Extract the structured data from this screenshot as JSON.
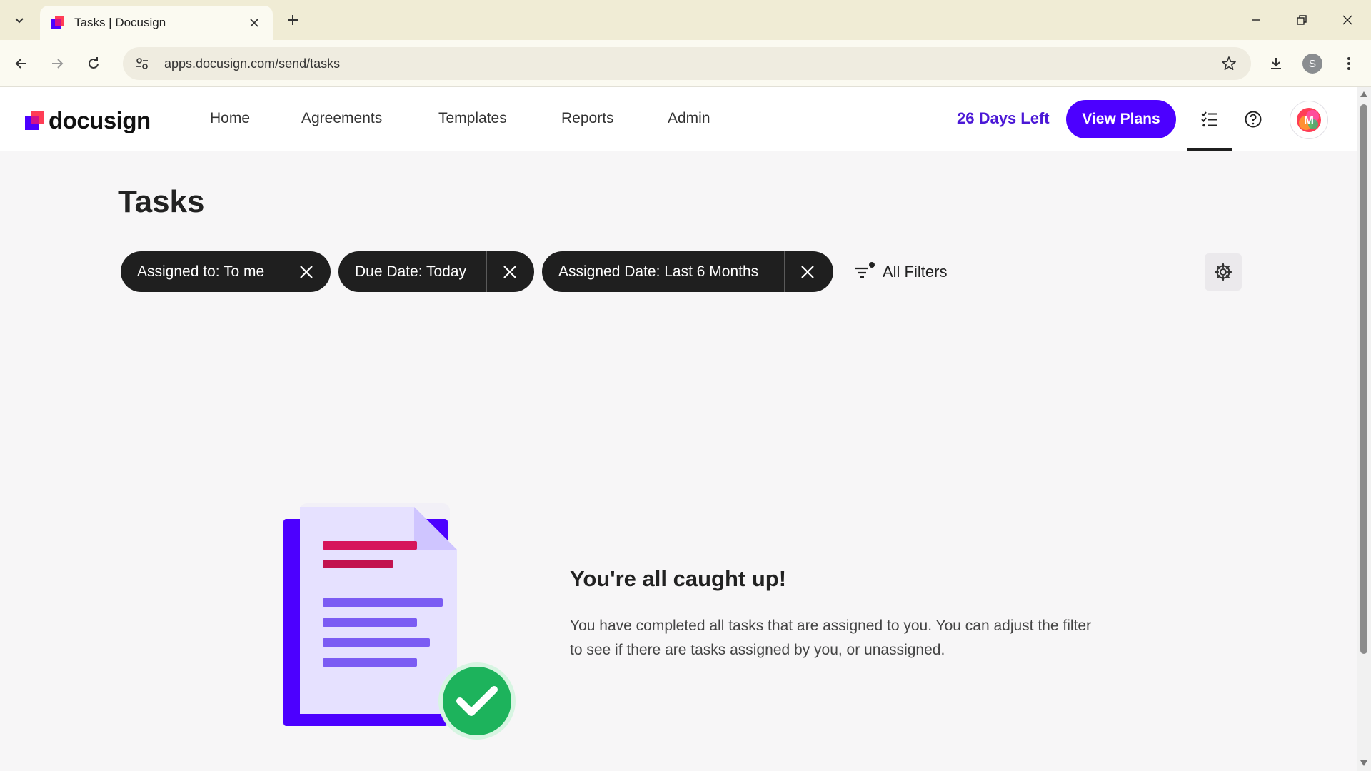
{
  "browser": {
    "tab_title": "Tasks | Docusign",
    "url": "apps.docusign.com/send/tasks",
    "profile_initial": "S"
  },
  "app": {
    "logo_text": "docusign",
    "nav": [
      "Home",
      "Agreements",
      "Templates",
      "Reports",
      "Admin"
    ],
    "trial_text": "26 Days Left",
    "view_plans_label": "View Plans",
    "avatar_initial": "M",
    "accent_color": "#4c00ff"
  },
  "page": {
    "title": "Tasks",
    "filters": [
      {
        "label": "Assigned to: To me"
      },
      {
        "label": "Due Date: Today"
      },
      {
        "label": "Assigned Date: Last 6 Months"
      }
    ],
    "all_filters_label": "All Filters",
    "empty_state": {
      "title": "You're all caught up!",
      "description": "You have completed all tasks that are assigned to you. You can adjust the filter to see if there are tasks assigned by you, or unassigned."
    }
  },
  "icons": {
    "tab_menu": "chevron-down-icon",
    "back": "arrow-left-icon",
    "forward": "arrow-right-icon",
    "reload": "reload-icon",
    "site_info": "tune-icon",
    "bookmark": "star-icon",
    "download": "download-icon",
    "menu": "more-vertical-icon",
    "tasks": "checklist-icon",
    "help": "help-icon",
    "filter": "filter-icon",
    "settings": "gear-icon"
  }
}
